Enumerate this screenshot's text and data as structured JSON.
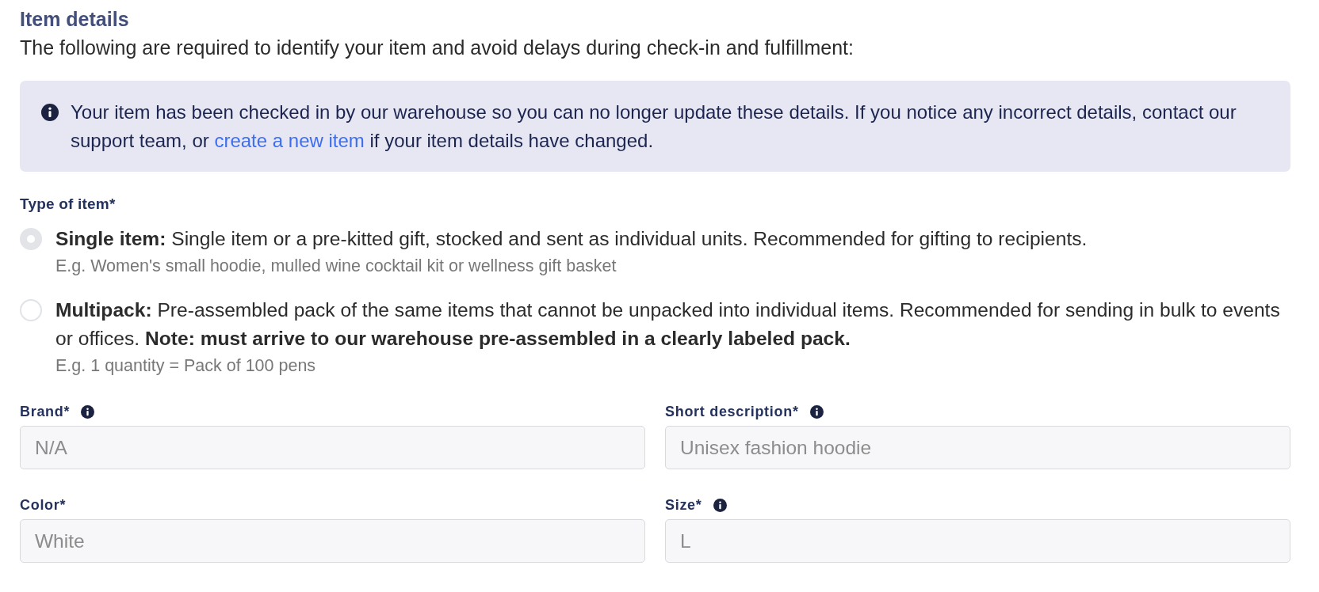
{
  "section": {
    "title": "Item details",
    "description": "The following are required to identify your item and avoid delays during check-in and fulfillment:"
  },
  "notice": {
    "text_before": "Your item has been checked in by our warehouse so you can no longer update these details. If you notice any incorrect details, contact our support team, or ",
    "link": "create a new item",
    "text_after": " if your item details have changed."
  },
  "item_type": {
    "label": "Type of item*",
    "disabled": true,
    "options": [
      {
        "text": "**Single item:** Single item or a pre-kitted gift, stocked and sent as individual units. Recommended for gifting to recipients.",
        "hint": "E.g. Women's small hoodie, mulled wine cocktail kit or wellness gift basket",
        "selected": true
      },
      {
        "text": "**Multipack:** Pre-assembled pack of the same items that cannot be unpacked into individual items. Recommended for sending in bulk to events or offices. **Note: must arrive to our warehouse pre-assembled in a clearly labeled pack.**",
        "hint": "E.g. 1 quantity = Pack of 100 pens",
        "selected": false
      }
    ]
  },
  "fields": [
    {
      "label": "Brand*",
      "info": true,
      "value": "N/A",
      "disabled": true
    },
    {
      "label": "Short description*",
      "info": true,
      "value": "Unisex fashion hoodie",
      "disabled": true
    },
    {
      "label": "Color*",
      "info": false,
      "value": "White",
      "disabled": true
    },
    {
      "label": "Size*",
      "info": true,
      "value": "L",
      "disabled": true
    }
  ]
}
